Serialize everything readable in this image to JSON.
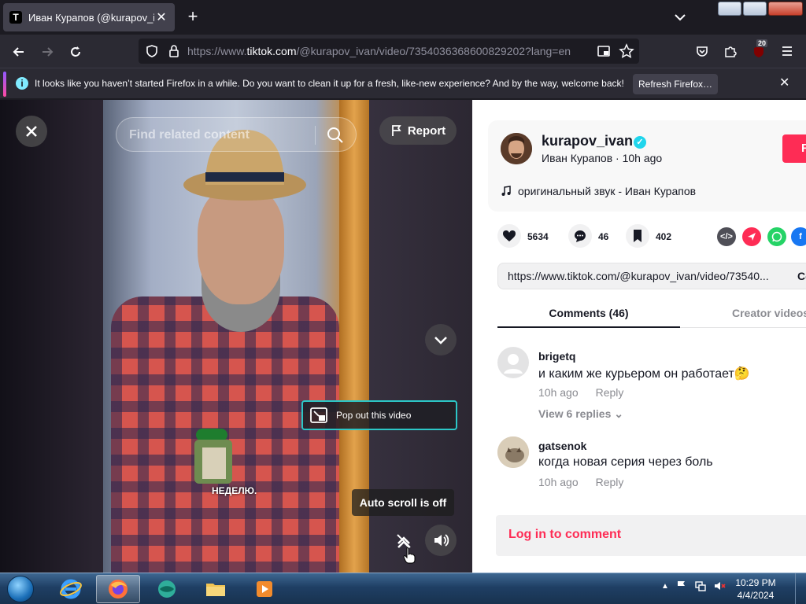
{
  "browser": {
    "tab_title": "Иван Курапов (@kurapov_ivan",
    "tab_favicon": "T",
    "new_tab_label": "+",
    "url_prefix": "https://www.",
    "url_host": "tiktok.com",
    "url_path": "/@kurapov_ivan/video/7354036368600829202?lang=en",
    "extension_badge": "20",
    "colors": {
      "chrome": "#1c1b22",
      "toolbar": "#2b2a33"
    }
  },
  "notification": {
    "message": "It looks like you haven’t started Firefox in a while. Do you want to clean it up for a fresh, like-new experience? And by the way, welcome back!",
    "button": "Refresh Firefox…"
  },
  "player": {
    "search_placeholder": "Find related content",
    "report_label": "Report",
    "popout_label": "Pop out this video",
    "autoscroll_label": "Auto scroll is off",
    "caption_text": "НЕДЕЛЮ."
  },
  "author": {
    "username": "kurapov_ivan",
    "display_name": "Иван Курапов",
    "time": "10h ago",
    "follow_label": "F",
    "music": "оригинальный звук - Иван Курапов"
  },
  "stats": {
    "likes": "5634",
    "comments": "46",
    "saves": "402"
  },
  "share": {
    "link": "https://www.tiktok.com/@kurapov_ivan/video/73540...",
    "copy_label": "Co"
  },
  "tabs": {
    "comments": "Comments (46)",
    "creator": "Creator videos"
  },
  "comments": [
    {
      "user": "brigetq",
      "text": "и каким же курьером он работает🤔",
      "time": "10h ago",
      "reply": "Reply",
      "view_replies": "View 6 replies"
    },
    {
      "user": "gatsenok",
      "text": "когда новая серия через боль",
      "time": "10h ago",
      "reply": "Reply"
    }
  ],
  "login": {
    "label": "Log in to comment"
  },
  "taskbar": {
    "time": "10:29 PM",
    "date": "4/4/2024"
  },
  "accent": {
    "tiktok_red": "#fe2c55",
    "popout_border": "#2cc7c7"
  }
}
